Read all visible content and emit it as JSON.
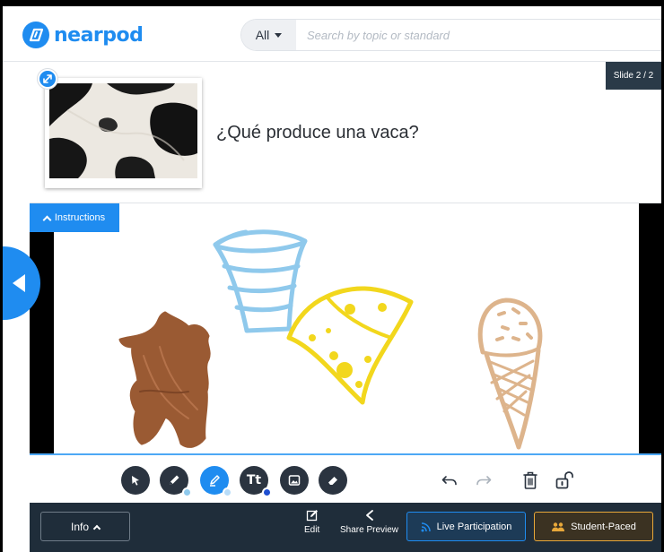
{
  "header": {
    "logo_text": "nearpod",
    "search_filter": "All",
    "search_placeholder": "Search by topic or standard"
  },
  "slide": {
    "title": "¿Qué produce una vaca?",
    "badge": "Slide 2 / 2",
    "instructions_label": "Instructions"
  },
  "canvas": {
    "drawings": [
      "glass-of-milk",
      "cheese",
      "cow",
      "ice-cream-cone"
    ],
    "colors": {
      "milk": "#8fc9ec",
      "cheese": "#f2d71d",
      "cow": "#9a5a33",
      "ice_cream": "#ddb48c"
    }
  },
  "tools": {
    "items": [
      "select-tool",
      "pen-tool",
      "highlighter-tool",
      "text-tool",
      "image-tool",
      "eraser-tool"
    ],
    "actions": [
      "undo",
      "redo",
      "delete",
      "unlock"
    ]
  },
  "footer": {
    "info_label": "Info",
    "edit_label": "Edit",
    "share_label": "Share Preview",
    "live_label": "Live Participation",
    "student_paced_label": "Student-Paced"
  },
  "colors": {
    "accent": "#1f8cf0",
    "footer_bg": "#1f2d3a",
    "toolbar_icon": "#2b3440",
    "student_paced_border": "#e8a83a"
  }
}
